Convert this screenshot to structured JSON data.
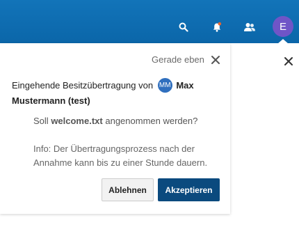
{
  "header": {
    "avatar_initial": "E",
    "colors": {
      "bar": "#0f6fb4",
      "avatar": "#6f55c7"
    },
    "icons": [
      "search-icon",
      "notifications-icon",
      "contacts-icon"
    ]
  },
  "notification": {
    "timestamp": "Gerade eben",
    "intro": "Eingehende Besitzübertragung von",
    "user_initials": "MM",
    "user_name": "Max Mustermann (test)",
    "question_prefix": "Soll",
    "file_name": "welcome.txt",
    "question_suffix": "angenommen werden?",
    "info": "Info: Der Übertragungsprozess nach der Annahme kann bis zu einer Stunde dauern.",
    "decline_label": "Ablehnen",
    "accept_label": "Akzeptieren"
  }
}
